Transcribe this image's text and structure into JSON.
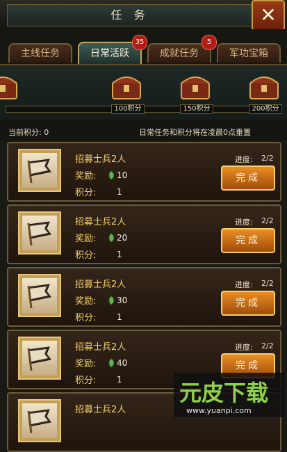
{
  "window": {
    "title": "任 务"
  },
  "tabs": [
    {
      "label": "主线任务",
      "badge": ""
    },
    {
      "label": "日常活跃",
      "badge": "35"
    },
    {
      "label": "成就任务",
      "badge": "5"
    },
    {
      "label": "军功宝箱",
      "badge": ""
    }
  ],
  "rewards": {
    "progress": 0.0,
    "milestones": [
      {
        "label": "100积分"
      },
      {
        "label": "150积分"
      },
      {
        "label": "200积分"
      }
    ]
  },
  "points_row": {
    "current": "当前积分: 0",
    "reset_note": "日常任务和积分将在凌晨0点重置"
  },
  "tasks": [
    {
      "title": "招募士兵2人",
      "reward_label": "奖励:",
      "reward": "10",
      "points_label": "积分:",
      "points": "1",
      "progress_label": "进度:",
      "progress": "2/2",
      "button": "完成"
    },
    {
      "title": "招募士兵2人",
      "reward_label": "奖励:",
      "reward": "20",
      "points_label": "积分:",
      "points": "1",
      "progress_label": "进度:",
      "progress": "2/2",
      "button": "完成"
    },
    {
      "title": "招募士兵2人",
      "reward_label": "奖励:",
      "reward": "30",
      "points_label": "积分:",
      "points": "1",
      "progress_label": "进度:",
      "progress": "2/2",
      "button": "完成"
    },
    {
      "title": "招募士兵2人",
      "reward_label": "奖励:",
      "reward": "40",
      "points_label": "积分:",
      "points": "1",
      "progress_label": "进度:",
      "progress": "2/2",
      "button": "完成"
    },
    {
      "title": "招募士兵2人",
      "reward_label": "奖励:",
      "reward": "",
      "points_label": "",
      "points": "",
      "progress_label": "",
      "progress": "",
      "button": ""
    }
  ],
  "watermark": {
    "main": "元皮下载",
    "url": "www.yuanpi.com"
  },
  "colors": {
    "accent_gold": "#f3d06b",
    "button_orange": "#e88e24",
    "tab_active": "#3e5c56",
    "badge_red": "#b01d14"
  }
}
